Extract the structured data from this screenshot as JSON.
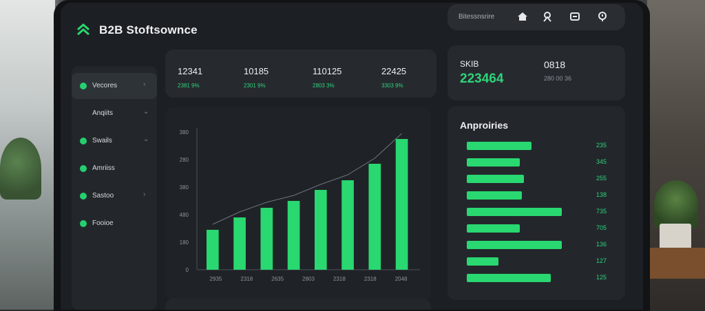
{
  "app": {
    "title": "B2B Stoftsownce"
  },
  "topbar": {
    "search_label": "Bitessnsrire",
    "icons": [
      "home-icon",
      "user-icon",
      "chat-icon",
      "bell-icon"
    ]
  },
  "sidebar": {
    "items": [
      {
        "label": "Vecores",
        "chevron": "›",
        "active": true
      },
      {
        "label": "Anqiits",
        "chevron": "⌄",
        "active": false
      },
      {
        "label": "Swails",
        "chevron": "⌄",
        "active": false
      },
      {
        "label": "Amriiss",
        "chevron": "",
        "active": false
      },
      {
        "label": "Sastoo",
        "chevron": "›",
        "active": false
      },
      {
        "label": "Fooioe",
        "chevron": "",
        "active": false
      }
    ]
  },
  "stats": [
    {
      "value": "12341",
      "sub": "2381 9%"
    },
    {
      "value": "10185",
      "sub": "2301 9%"
    },
    {
      "value": "110125",
      "sub": "2803 3%"
    },
    {
      "value": "22425",
      "sub": "3303 9%"
    }
  ],
  "summary": {
    "label": "SKIB",
    "value": "223464",
    "label2": "0818",
    "sub2": "280 00 36"
  },
  "chart_data": {
    "type": "bar",
    "categories": [
      "2935",
      "2318",
      "2635",
      "2803",
      "2318",
      "2318",
      "2048"
    ],
    "values": [
      1.45,
      1.9,
      2.25,
      2.5,
      2.9,
      3.25,
      3.85,
      4.75
    ],
    "ylim": [
      0,
      5
    ],
    "ytick_labels": [
      "0",
      "180",
      "480",
      "380",
      "280",
      "380"
    ],
    "accent": "#29d870",
    "trend_line": true
  },
  "bars_panel": {
    "title": "Anproiries",
    "rows": [
      {
        "value": "235",
        "fraction": 0.55
      },
      {
        "value": "345",
        "fraction": 0.45
      },
      {
        "value": "255",
        "fraction": 0.49
      },
      {
        "value": "138",
        "fraction": 0.47
      },
      {
        "value": "735",
        "fraction": 0.81
      },
      {
        "value": "705",
        "fraction": 0.45
      },
      {
        "value": "136",
        "fraction": 0.81
      },
      {
        "value": "127",
        "fraction": 0.27
      },
      {
        "value": "125",
        "fraction": 0.72
      }
    ]
  }
}
